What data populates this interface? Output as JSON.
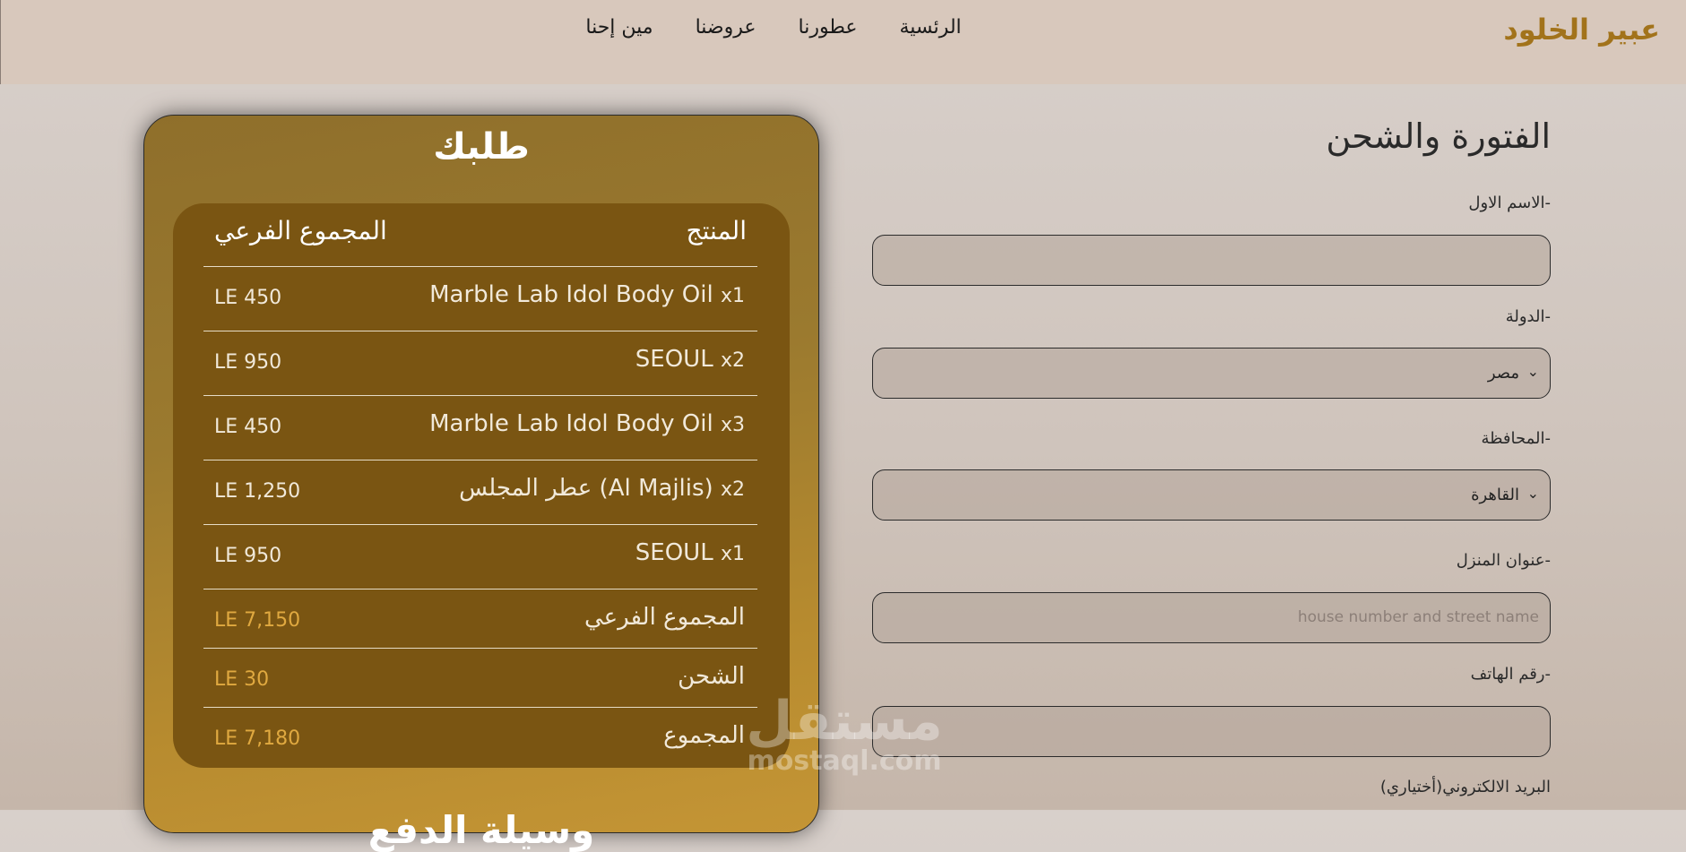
{
  "header": {
    "brand": "عبير الخلود",
    "nav": [
      "الرئسية",
      "عطورنا",
      "عروضنا",
      "مين إحنا"
    ]
  },
  "form": {
    "title": "الفتورة والشحن",
    "first_name_label": "-الاسم الاول",
    "country_label": "-الدولة",
    "country_value": "مصر",
    "governorate_label": "-المحافظة",
    "governorate_value": "القاهرة",
    "address_label": "-عنوان المنزل",
    "address_placeholder": "house number and street name",
    "phone_label": "-رقم الهاتف",
    "email_label": "البريد الالكتروني(أختياري)"
  },
  "order": {
    "title": "طلبك",
    "col_product": "المنتج",
    "col_subtotal": "المجموع الفرعي",
    "items": [
      {
        "name": "Marble Lab Idol Body Oil",
        "qty": "x1",
        "price": "LE 450"
      },
      {
        "name": "SEOUL",
        "qty": "x2",
        "price": "LE 950"
      },
      {
        "name": "Marble Lab Idol Body Oil",
        "qty": "x3",
        "price": "LE 450"
      },
      {
        "name": "عطر المجلس (Al Majlis)",
        "qty": "x2",
        "price": "LE 1,250"
      },
      {
        "name": "SEOUL",
        "qty": "x1",
        "price": "LE 950"
      }
    ],
    "subtotal_label": "المجموع الفرعي",
    "subtotal_value": "LE 7,150",
    "shipping_label": "الشحن",
    "shipping_value": "LE 30",
    "total_label": "المجموع",
    "total_value": "LE 7,180",
    "next_section": "وسيلة الدفع"
  },
  "watermark": {
    "line1": "مستقل",
    "line2": "mostaql.com"
  }
}
